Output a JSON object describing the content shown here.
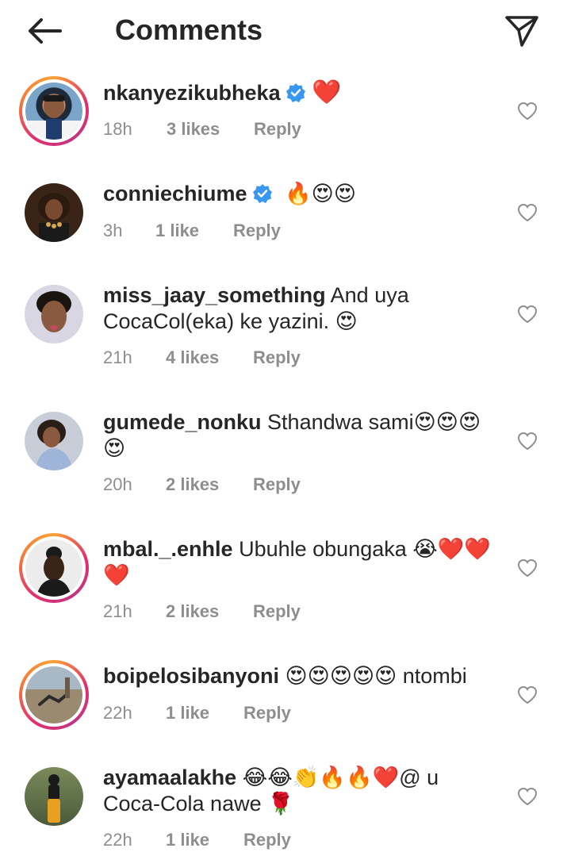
{
  "header": {
    "title": "Comments",
    "back_icon": "arrow-left-icon",
    "send_icon": "paper-plane-icon"
  },
  "colors": {
    "text": "#262626",
    "meta": "#8e8e8e",
    "verified": "#3897f0",
    "heart": "#e0142a"
  },
  "comments": [
    {
      "username": "nkanyezikubheka",
      "verified": true,
      "text": "❤️",
      "time": "18h",
      "likes": "3 likes",
      "reply": "Reply",
      "story_ring": true
    },
    {
      "username": "conniechiume",
      "verified": true,
      "text": "🔥😍😍",
      "time": "3h",
      "likes": "1 like",
      "reply": "Reply",
      "story_ring": false
    },
    {
      "username": "miss_jaay_something",
      "verified": false,
      "text": "And uya CocaCol(eka)  ke yazini. 😍",
      "time": "21h",
      "likes": "4 likes",
      "reply": "Reply",
      "story_ring": false
    },
    {
      "username": "gumede_nonku",
      "verified": false,
      "text": "Sthandwa sami😍😍😍😍",
      "time": "20h",
      "likes": "2 likes",
      "reply": "Reply",
      "story_ring": false
    },
    {
      "username": "mbal._.enhle",
      "verified": false,
      "text": "Ubuhle obungaka 😭❤️❤️❤️",
      "time": "21h",
      "likes": "2 likes",
      "reply": "Reply",
      "story_ring": true
    },
    {
      "username": "boipelosibanyoni",
      "verified": false,
      "text": "😍😍😍😍😍 ntombi",
      "time": "22h",
      "likes": "1 like",
      "reply": "Reply",
      "story_ring": true
    },
    {
      "username": "ayamaalakhe",
      "verified": false,
      "text": "😂😂👏🔥🔥❤️@ u Coca-Cola nawe 🌹",
      "time": "22h",
      "likes": "1 like",
      "reply": "Reply",
      "story_ring": false
    }
  ]
}
